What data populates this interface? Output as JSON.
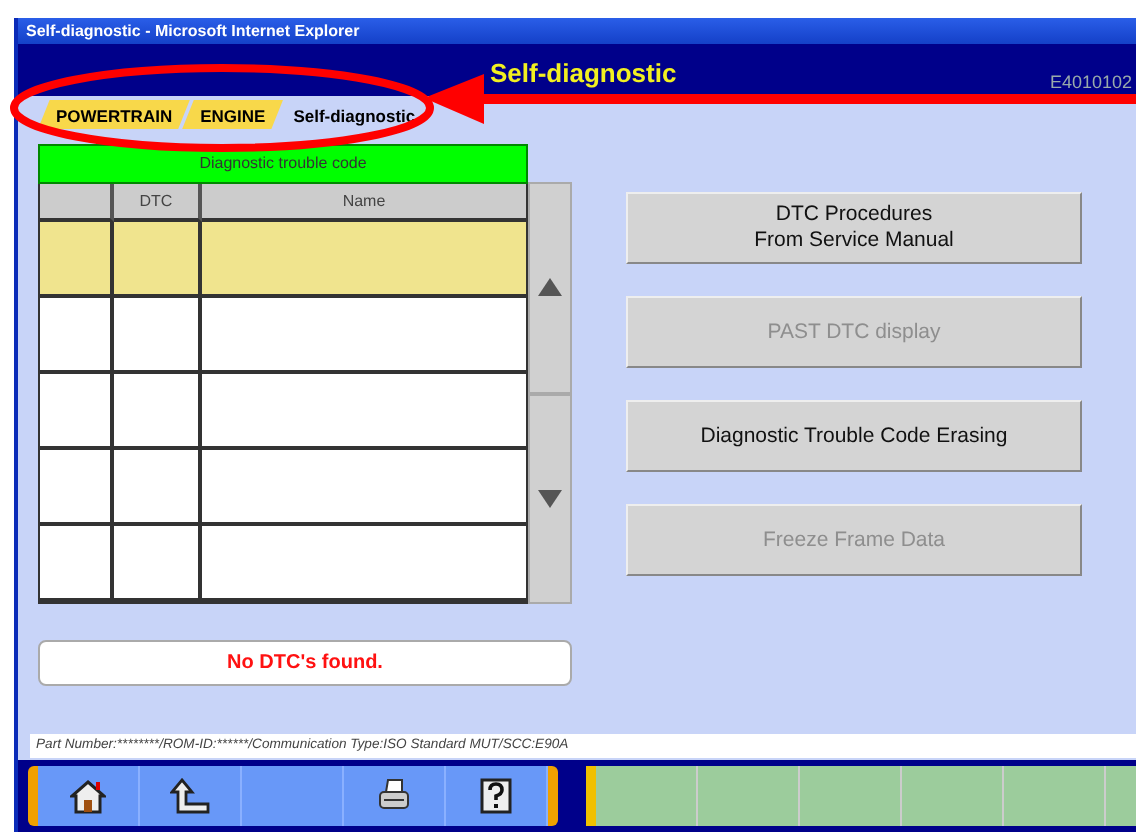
{
  "window": {
    "title": "Self-diagnostic - Microsoft Internet Explorer"
  },
  "header": {
    "title": "Self-diagnostic",
    "screen_code": "E4010102"
  },
  "breadcrumb": [
    {
      "label": "POWERTRAIN",
      "selected": false
    },
    {
      "label": "ENGINE",
      "selected": false
    },
    {
      "label": "Self-diagnostic",
      "selected": true
    }
  ],
  "table": {
    "title": "Diagnostic trouble code",
    "columns": [
      "",
      "DTC",
      "Name"
    ],
    "rows": [
      {
        "selected": true
      },
      {
        "selected": false
      },
      {
        "selected": false
      },
      {
        "selected": false
      },
      {
        "selected": false
      }
    ]
  },
  "scroll_buttons": [
    {
      "kind": "up"
    },
    {
      "kind": "down"
    }
  ],
  "buttons": [
    {
      "label": "DTC Procedures\nFrom Service Manual",
      "disabled": false
    },
    {
      "label": "PAST DTC display",
      "disabled": true
    },
    {
      "label": "Diagnostic Trouble Code Erasing",
      "disabled": false
    },
    {
      "label": "Freeze Frame Data",
      "disabled": true
    }
  ],
  "message": "No DTC's found.",
  "status_bar": "Part Number:********/ROM-ID:******/Communication Type:ISO Standard MUT/SCC:E90A",
  "toolbar": [
    {
      "kind": "home"
    },
    {
      "kind": "back"
    },
    {
      "kind": "blank"
    },
    {
      "kind": "print"
    },
    {
      "kind": "help"
    }
  ],
  "function_keys": [
    {
      "kind": "blank"
    },
    {
      "kind": "blank"
    },
    {
      "kind": "blank"
    },
    {
      "kind": "blank"
    },
    {
      "kind": "blank"
    },
    {
      "kind": "blank"
    }
  ],
  "annotation": {
    "kind": "arrow"
  }
}
